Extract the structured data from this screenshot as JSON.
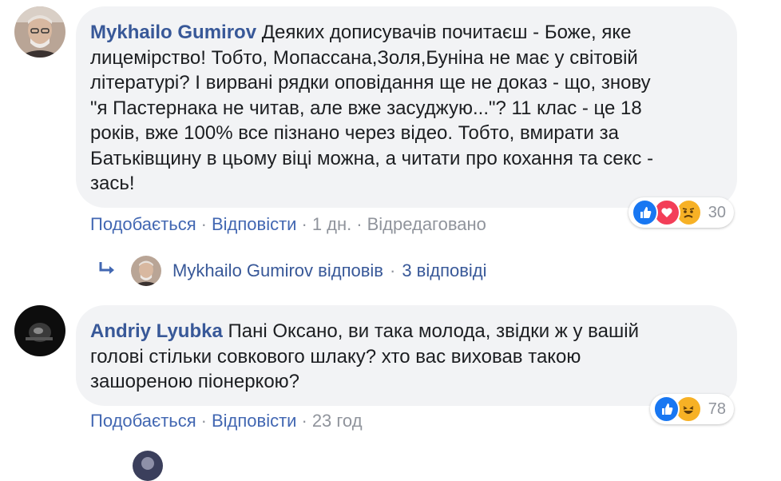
{
  "comments": [
    {
      "author": "Mykhailo Gumirov",
      "text_lines": [
        "Деяких дописувачів почитаєш - Боже, яке",
        "лицемірство! Тобто, Мопассана,Золя,Буніна не має у світовій",
        "літературі? І вирвані рядки оповідання ще не доказ - що, знову",
        "\"я Пастернака не читав, але вже засуджую...\"? 11 клас - це 18",
        "років, вже 100% все пізнано через відео. Тобто, вмирати за",
        "Батьківщину в цьому віці можна, а читати про кохання та секс -",
        "зась!"
      ],
      "actions": {
        "like": "Подобається",
        "reply": "Відповісти",
        "time": "1 дн.",
        "edited": "Відредаговано"
      },
      "reaction_count": "30",
      "reactions": [
        "like-reaction",
        "love-reaction",
        "sad-reaction"
      ],
      "replies_link": {
        "author": "Mykhailo Gumirov",
        "verb": "відповів",
        "count": "3 відповіді"
      }
    },
    {
      "author": "Andriy Lyubka",
      "text_lines": [
        "Пані Оксано, ви така молода, звідки ж у вашій",
        "голові стільки совкового шлаку? хто вас виховав такою",
        "зашореною піонеркою?"
      ],
      "actions": {
        "like": "Подобається",
        "reply": "Відповісти",
        "time": "23 год"
      },
      "reaction_count": "78",
      "reactions": [
        "like-reaction",
        "haha-reaction"
      ]
    }
  ],
  "colors": {
    "name": "#385898",
    "link": "#4267b2",
    "meta": "#90949c",
    "bubble": "#f2f3f5",
    "like": "#1877f2",
    "love": "#f33e58",
    "emoji": "#f7b125"
  }
}
